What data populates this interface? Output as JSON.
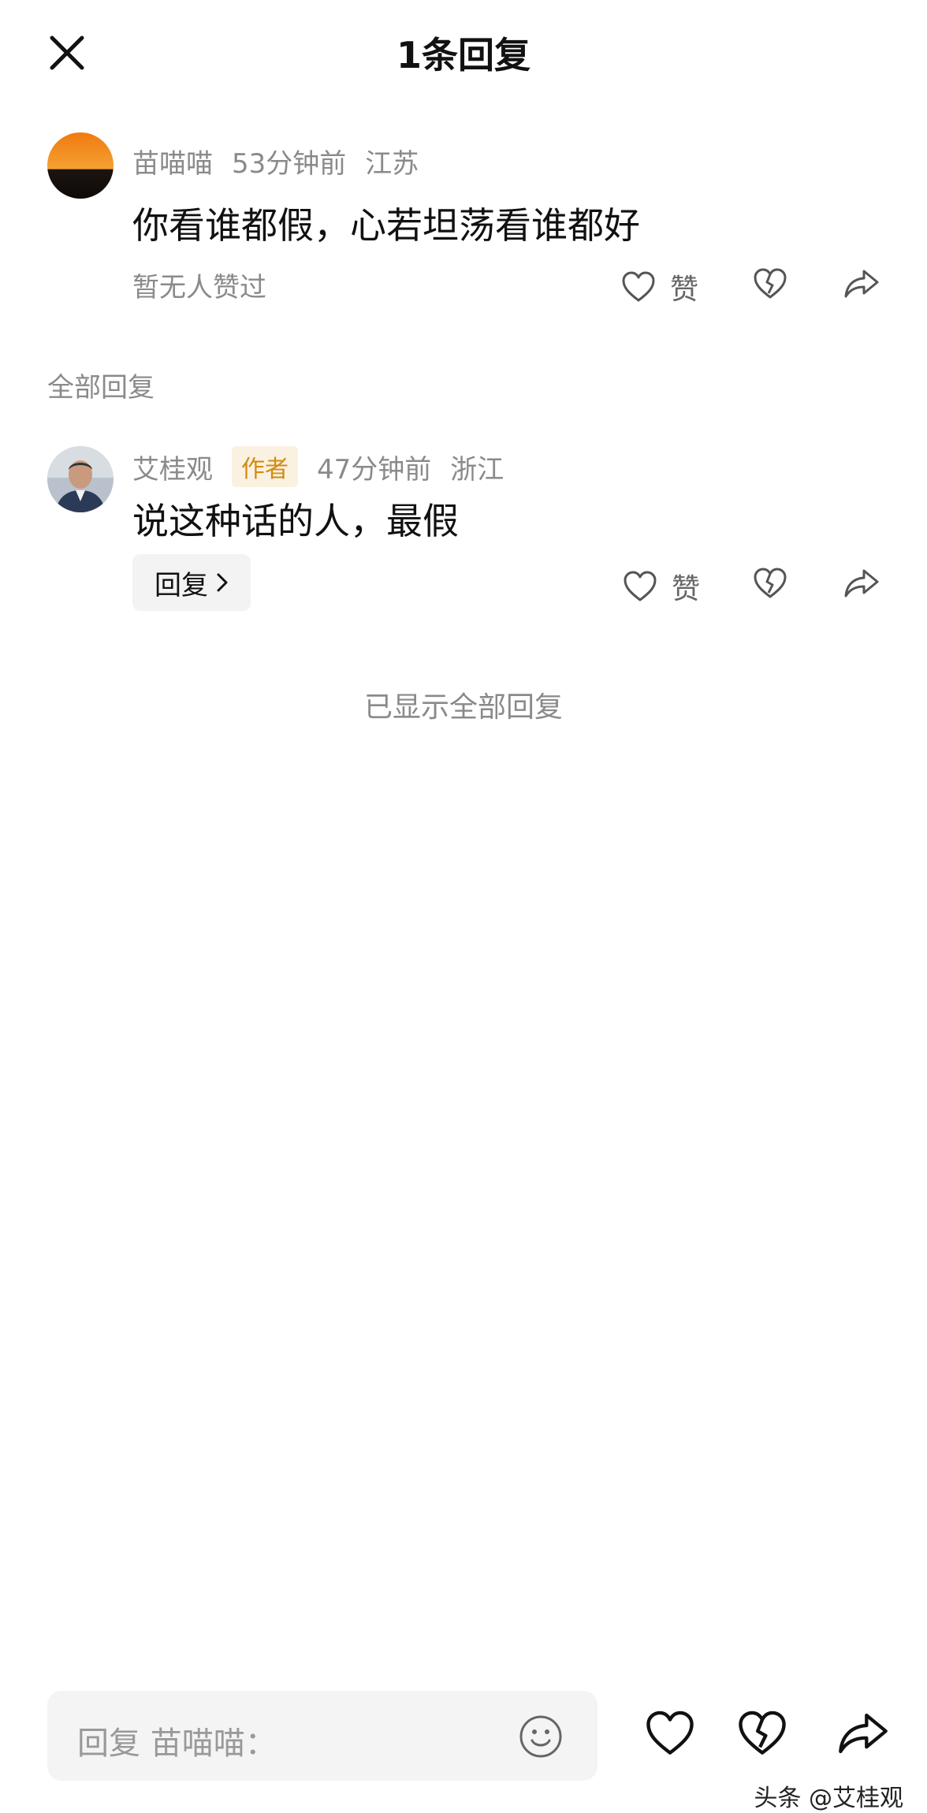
{
  "header": {
    "title": "1条回复"
  },
  "comment": {
    "username": "苗喵喵",
    "time": "53分钟前",
    "location": "江苏",
    "text": "你看谁都假，心若坦荡看谁都好",
    "likes_text": "暂无人赞过",
    "like_label": "赞"
  },
  "replies_section": {
    "label": "全部回复"
  },
  "reply": {
    "username": "艾桂观",
    "badge": "作者",
    "time": "47分钟前",
    "location": "浙江",
    "text": "说这种话的人，最假",
    "reply_button": "回复",
    "like_label": "赞"
  },
  "end_text": "已显示全部回复",
  "bottom_bar": {
    "placeholder": "回复 苗喵喵："
  },
  "watermark": "头条 @艾桂观",
  "icons": [
    "close-icon",
    "heart-icon",
    "broken-heart-icon",
    "share-icon",
    "emoji-icon",
    "chevron-right-icon"
  ]
}
